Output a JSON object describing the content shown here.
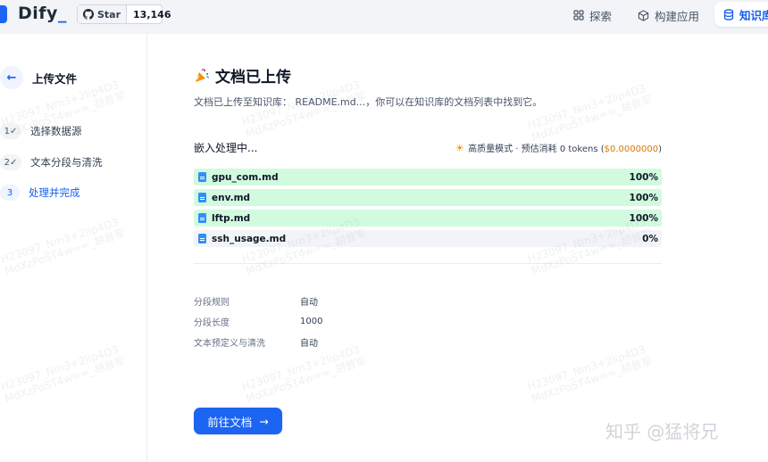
{
  "brand": {
    "name": "Dify",
    "underscore": "_"
  },
  "github": {
    "star_label": "Star",
    "count": "13,146",
    "icon": "github-icon"
  },
  "nav": {
    "explore": {
      "label": "探索",
      "icon": "grid-icon"
    },
    "build": {
      "label": "构建应用",
      "icon": "cube-icon"
    },
    "knowledge": {
      "label": "知识库",
      "icon": "database-icon"
    }
  },
  "sidebar": {
    "title": "上传文件",
    "steps": [
      {
        "num": "1",
        "label": "选择数据源",
        "done": true
      },
      {
        "num": "2",
        "label": "文本分段与清洗",
        "done": true
      },
      {
        "num": "3",
        "label": "处理并完成",
        "done": false
      }
    ]
  },
  "main": {
    "title": "文档已上传",
    "desc_prefix": "文档已上传至知识库：",
    "desc_name": "README.md...",
    "desc_suffix": "，你可以在知识库的文档列表中找到它。",
    "embed_label": "嵌入处理中...",
    "embed_mode": "高质量模式 · 预估消耗 0 tokens (",
    "embed_cost": "$0.0000000",
    "embed_close": ")",
    "files": [
      {
        "name": "gpu_com.md",
        "progress": "100%",
        "fraction": 1.0
      },
      {
        "name": "env.md",
        "progress": "100%",
        "fraction": 1.0
      },
      {
        "name": "lftp.md",
        "progress": "100%",
        "fraction": 1.0
      },
      {
        "name": "ssh_usage.md",
        "progress": "0%",
        "fraction": 0.0
      }
    ],
    "rules": [
      {
        "label": "分段规则",
        "value": "自动"
      },
      {
        "label": "分段长度",
        "value": "1000"
      },
      {
        "label": "文本预定义与清洗",
        "value": "自动"
      }
    ],
    "go_button": "前往文档",
    "go_arrow": "→"
  },
  "watermark": {
    "line1": "H23097_Nm3+2lip4D3",
    "line2": "MdXzPoST4w==_胡普军"
  },
  "footer_mark": "知乎 @猛将兄",
  "colors": {
    "accent": "#1c64f2",
    "progress_done": "#d1fadf",
    "cost": "#d97706"
  }
}
